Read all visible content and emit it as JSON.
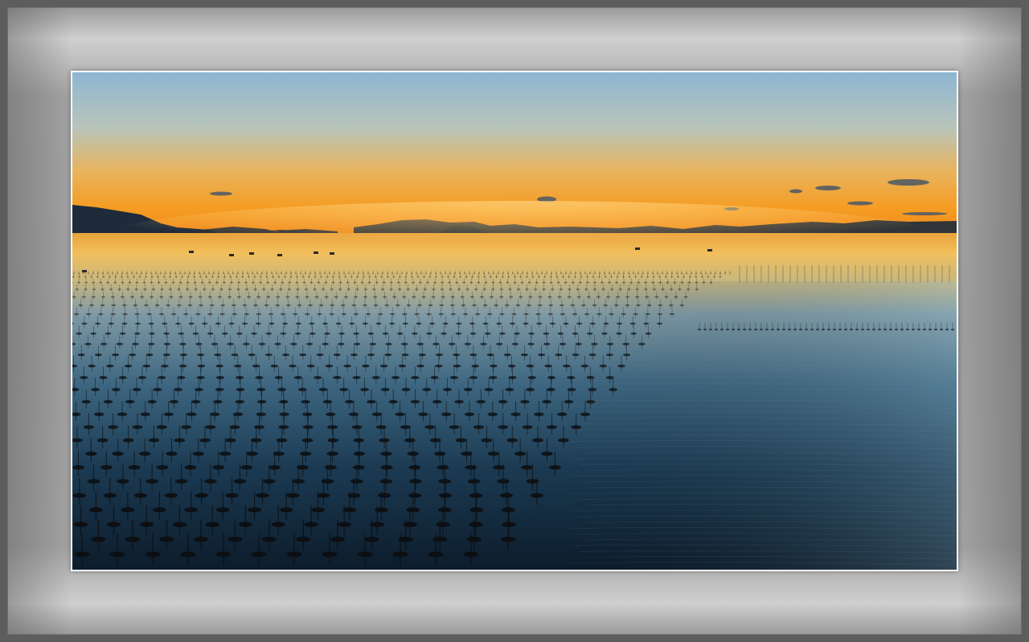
{
  "scene": {
    "subject": "sunset-over-seaweed-farm",
    "colors": {
      "sky_top": "#8cb4d2",
      "sky_mid": "#e8b45a",
      "sky_horizon": "#f59a1e",
      "water_glow": "#f2b84a",
      "water_deep": "#0e2233",
      "mountains": "#1e2a3a",
      "mat": "#a4a4a4",
      "frame": "#5d5d5d",
      "border": "#ffffff"
    }
  }
}
